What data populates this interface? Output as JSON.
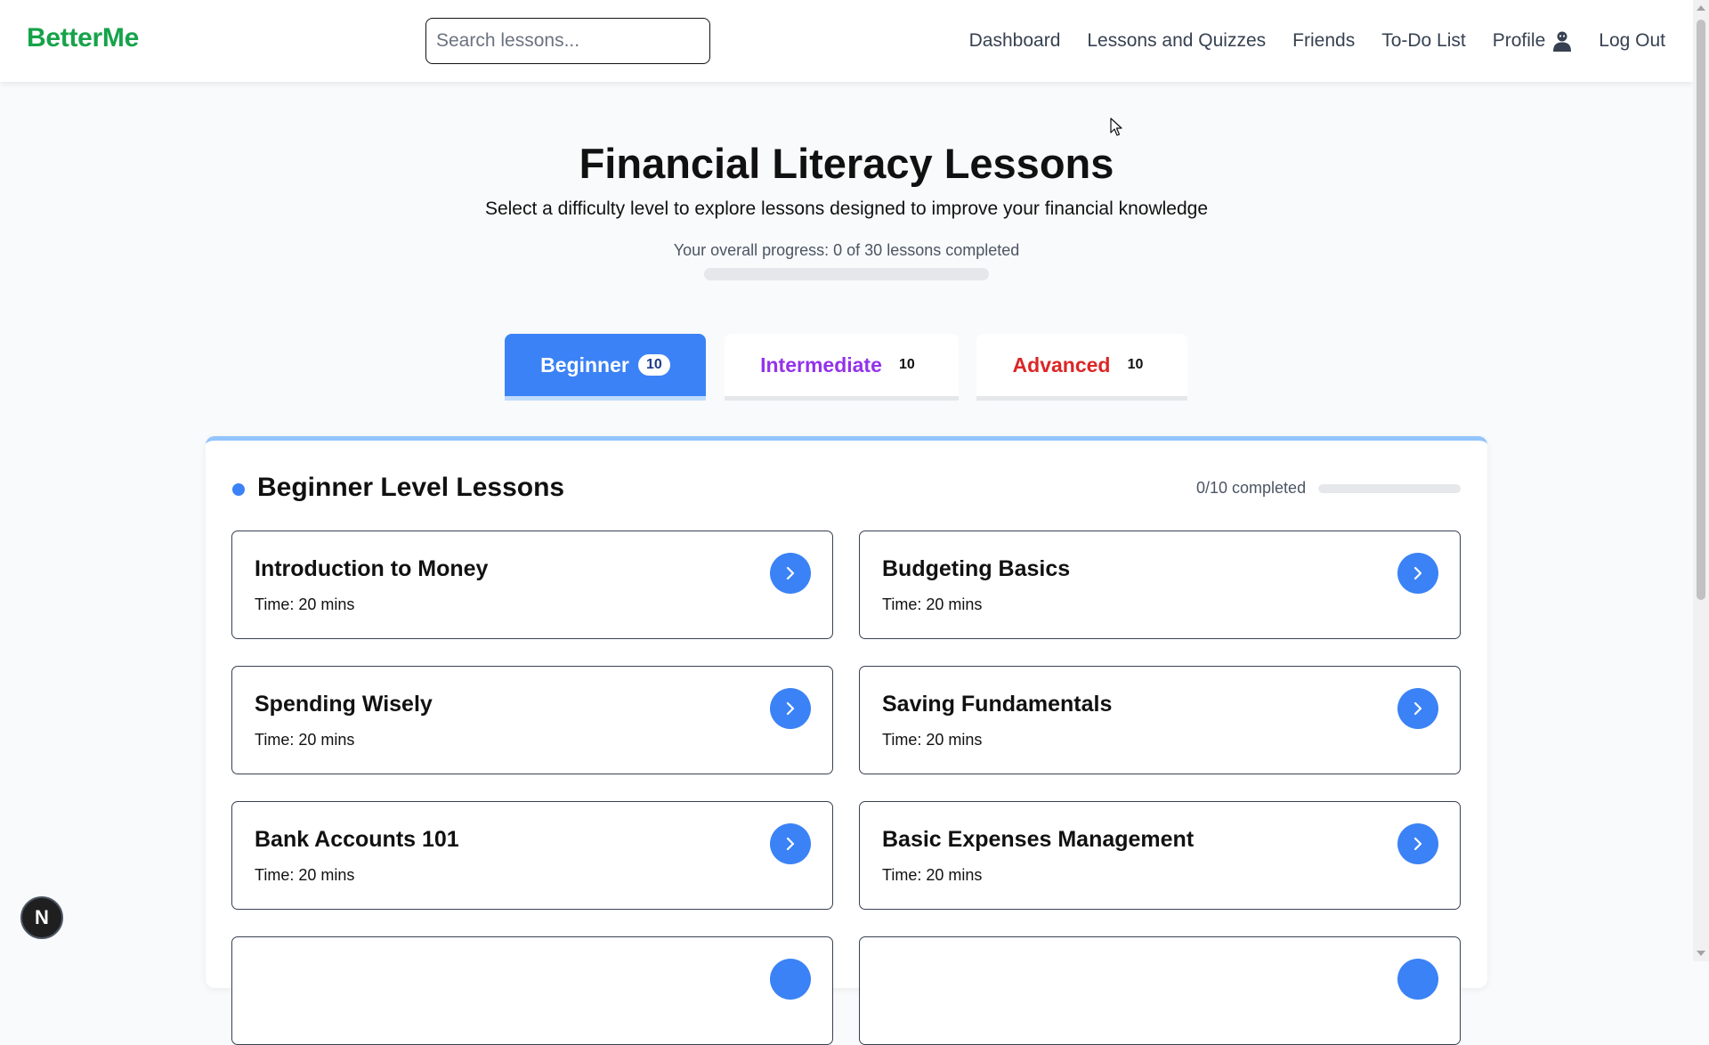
{
  "header": {
    "brand": "BetterMe",
    "search_placeholder": "Search lessons...",
    "nav": {
      "dashboard": "Dashboard",
      "lessons": "Lessons and Quizzes",
      "friends": "Friends",
      "todo": "To-Do List",
      "profile": "Profile",
      "logout": "Log Out"
    }
  },
  "hero": {
    "title": "Financial Literacy Lessons",
    "subtitle": "Select a difficulty level to explore lessons designed to improve your financial knowledge",
    "progress_text": "Your overall progress: 0 of 30 lessons completed",
    "progress_fraction": 0
  },
  "tabs": [
    {
      "label": "Beginner",
      "count": "10",
      "active": true
    },
    {
      "label": "Intermediate",
      "count": "10",
      "active": false
    },
    {
      "label": "Advanced",
      "count": "10",
      "active": false
    }
  ],
  "panel": {
    "title": "Beginner Level Lessons",
    "completed_text": "0/10 completed",
    "progress_fraction": 0,
    "lessons": [
      {
        "title": "Introduction to Money",
        "time": "Time: 20 mins"
      },
      {
        "title": "Budgeting Basics",
        "time": "Time: 20 mins"
      },
      {
        "title": "Spending Wisely",
        "time": "Time: 20 mins"
      },
      {
        "title": "Saving Fundamentals",
        "time": "Time: 20 mins"
      },
      {
        "title": "Bank Accounts 101",
        "time": "Time: 20 mins"
      },
      {
        "title": "Basic Expenses Management",
        "time": "Time: 20 mins"
      }
    ]
  },
  "floating_badge": "N",
  "colors": {
    "brand": "#16a34a",
    "accent": "#3b82f6",
    "intermediate": "#9333ea",
    "advanced": "#dc2626"
  },
  "icons": {
    "profile": "person-icon",
    "lesson_action": "chevron-right-icon",
    "cursor": "mouse-pointer-icon"
  }
}
